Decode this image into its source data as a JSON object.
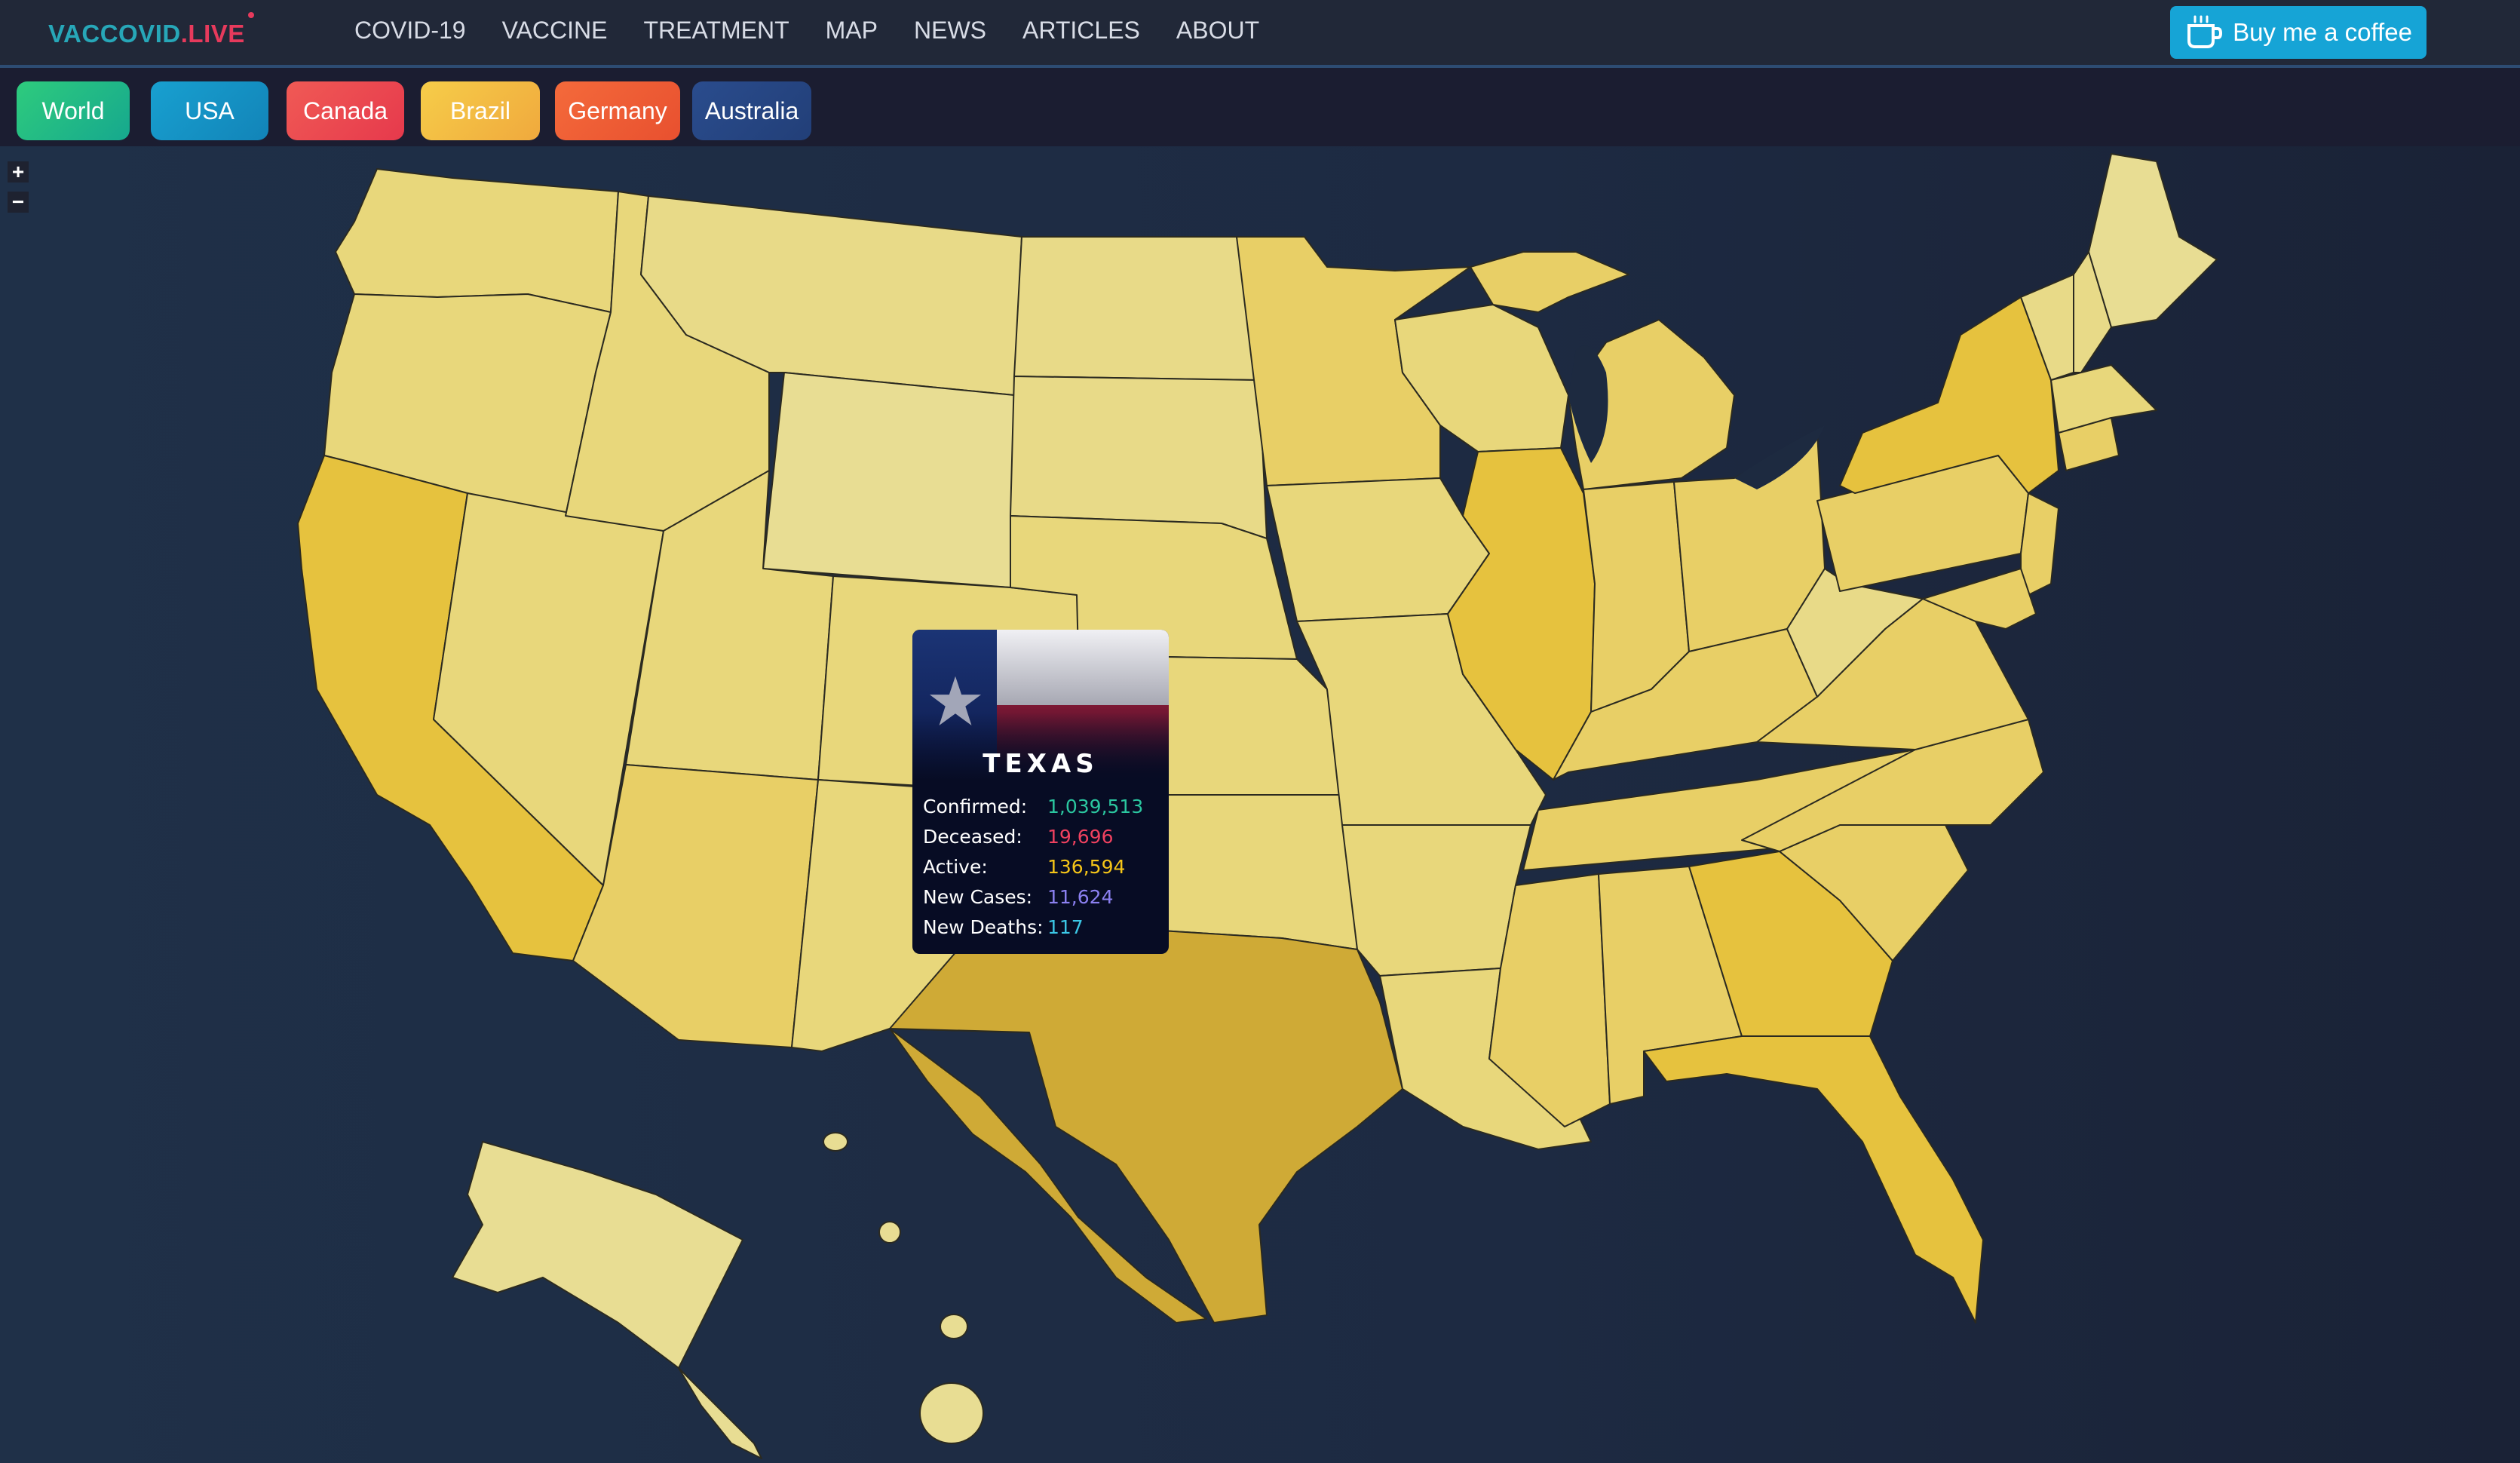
{
  "brand": {
    "part1": "VACCOVID",
    "part2": ".LIVE"
  },
  "nav": [
    "COVID-19",
    "VACCINE",
    "TREATMENT",
    "MAP",
    "NEWS",
    "ARTICLES",
    "ABOUT"
  ],
  "coffee": {
    "label": "Buy me a coffee",
    "icon": "coffee-cup-icon"
  },
  "countries": [
    {
      "label": "World",
      "color_from": "#2ecb7d",
      "color_to": "#16a88e"
    },
    {
      "label": "USA",
      "color_from": "#18a0d0",
      "color_to": "#1284b8"
    },
    {
      "label": "Canada",
      "color_from": "#f05a55",
      "color_to": "#e6394c"
    },
    {
      "label": "Brazil",
      "color_from": "#f6cd49",
      "color_to": "#f0a93d"
    },
    {
      "label": "Germany",
      "color_from": "#f46a3b",
      "color_to": "#e8502f"
    },
    {
      "label": "Australia",
      "color_from": "#2a4c8d",
      "color_to": "#223f78"
    }
  ],
  "zoom": {
    "in": "+",
    "out": "−"
  },
  "map": {
    "colors": {
      "light": "#e8dd93",
      "mid": "#e8cf66",
      "strong": "#e6c23e",
      "texas": "#cfaa36",
      "border": "#2b2a20"
    }
  },
  "tooltip": {
    "title": "TEXAS",
    "flag_icon": "texas-flag-icon",
    "rows": [
      {
        "key": "Confirmed:",
        "value": "1,039,513",
        "color": "#2bc7a0"
      },
      {
        "key": "Deceased:",
        "value": "19,696",
        "color": "#f0415f"
      },
      {
        "key": "Active:",
        "value": "136,594",
        "color": "#f5c518"
      },
      {
        "key": "New Cases:",
        "value": "11,624",
        "color": "#8b80f0"
      },
      {
        "key": "New Deaths:",
        "value": "117",
        "color": "#3cc8e6"
      }
    ]
  }
}
